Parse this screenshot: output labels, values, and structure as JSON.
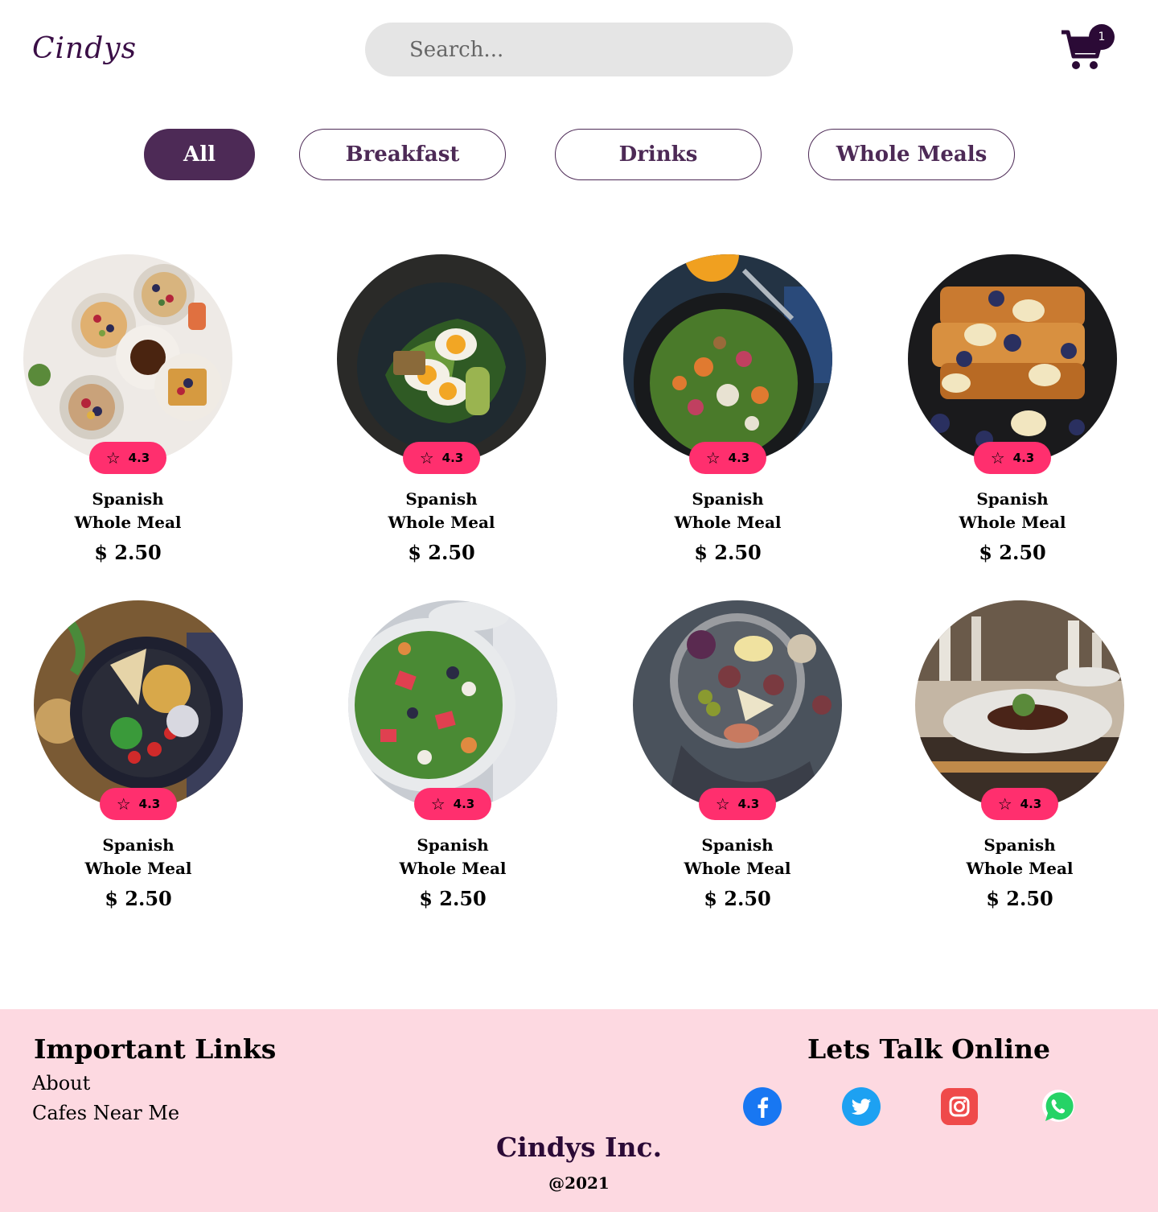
{
  "header": {
    "logo": "Cindys",
    "search_placeholder": "Search...",
    "cart_count": "1"
  },
  "filters": [
    {
      "label": "All",
      "active": true
    },
    {
      "label": "Breakfast",
      "active": false
    },
    {
      "label": "Drinks",
      "active": false
    },
    {
      "label": "Whole Meals",
      "active": false
    }
  ],
  "products": [
    {
      "name": "Spanish Whole Meal",
      "price": "$ 2.50",
      "rating": "4.3",
      "image": "breakfast-spread"
    },
    {
      "name": "Spanish Whole Meal",
      "price": "$ 2.50",
      "rating": "4.3",
      "image": "egg-avocado-toast"
    },
    {
      "name": "Spanish Whole Meal",
      "price": "$ 2.50",
      "rating": "4.3",
      "image": "green-salad"
    },
    {
      "name": "Spanish Whole Meal",
      "price": "$ 2.50",
      "rating": "4.3",
      "image": "french-toast"
    },
    {
      "name": "Spanish Whole Meal",
      "price": "$ 2.50",
      "rating": "4.3",
      "image": "chickpea-bowl"
    },
    {
      "name": "Spanish Whole Meal",
      "price": "$ 2.50",
      "rating": "4.3",
      "image": "watermelon-salad"
    },
    {
      "name": "Spanish Whole Meal",
      "price": "$ 2.50",
      "rating": "4.3",
      "image": "fig-platter"
    },
    {
      "name": "Spanish Whole Meal",
      "price": "$ 2.50",
      "rating": "4.3",
      "image": "restaurant-plate"
    }
  ],
  "footer": {
    "links_title": "Important Links",
    "links": [
      "About",
      "Cafes Near Me"
    ],
    "social_title": "Lets Talk Online",
    "social": [
      "facebook-icon",
      "twitter-icon",
      "instagram-icon",
      "whatsapp-icon"
    ],
    "brand": "Cindys Inc.",
    "year": "@2021"
  },
  "colors": {
    "brand": "#4d2a56",
    "rating_badge": "#ff2f6e",
    "footer_bg": "#fdd9e1"
  }
}
